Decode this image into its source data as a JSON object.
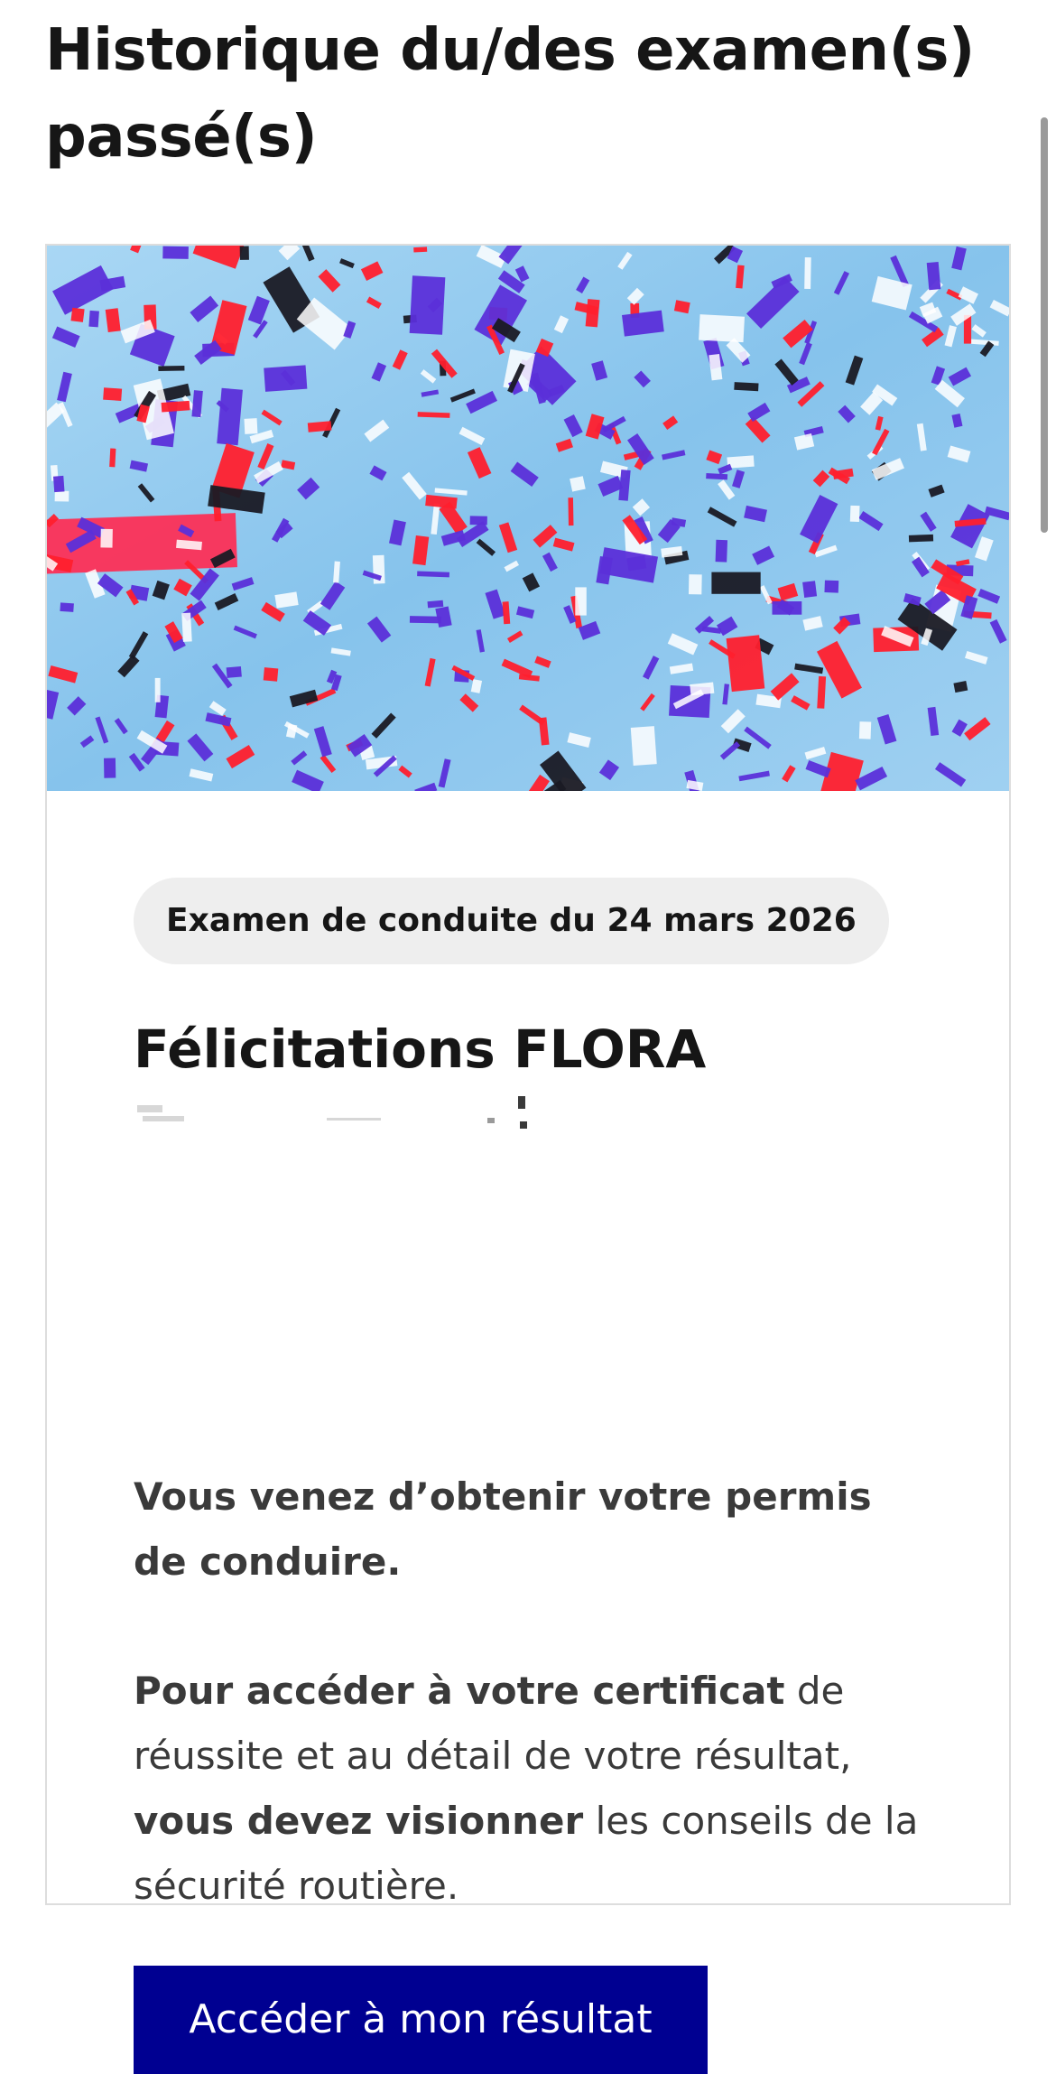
{
  "page": {
    "title": "Historique du/des examen(s) passé(s)"
  },
  "exam_card": {
    "hero_image": "confetti-celebration-image",
    "exam_tag": "Examen de conduite du 24 mars 2026",
    "congrats": "Félicitations FLORA",
    "message": "Vous venez d’obtenir votre permis de conduire.",
    "instructions": {
      "part1_bold": "Pour accéder à votre certificat",
      "part2": " de réussite et au détail de votre résultat, ",
      "part3_bold": "vous devez visionner",
      "part4": " les conseils de la sécurité routière."
    },
    "button_label": "Accéder à mon résultat"
  },
  "colors": {
    "primary_button": "#000091",
    "tag_background": "#eeeeee",
    "hero_sky": "#8fc8ee",
    "confetti": [
      "#5b2fd9",
      "#ff1f2d",
      "#1a1a24",
      "#ffffff"
    ]
  }
}
